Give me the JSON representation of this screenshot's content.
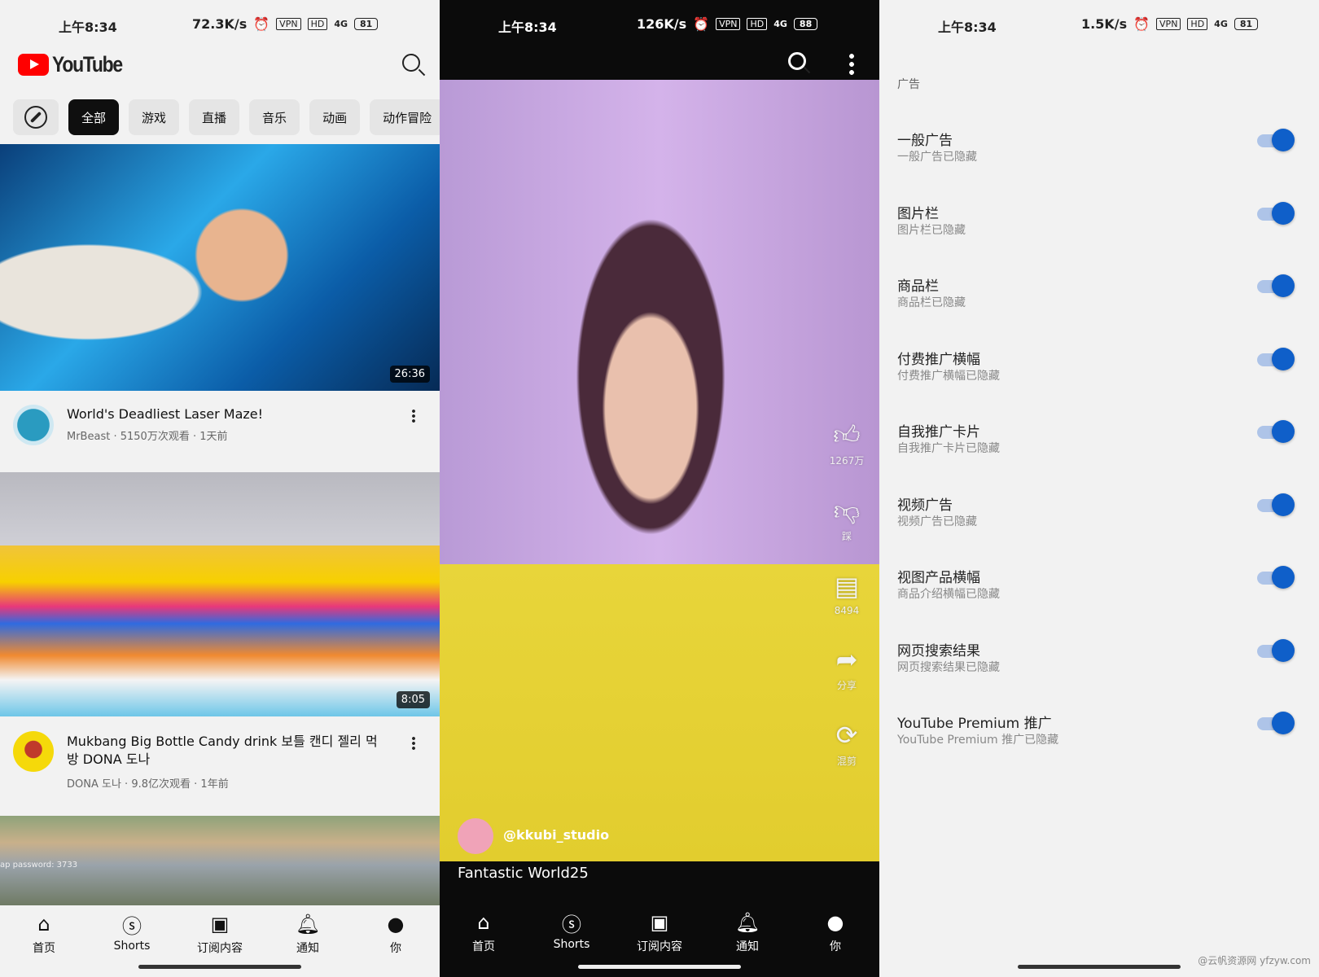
{
  "panel_home": {
    "status": {
      "time": "上午8:34",
      "speed": "72.3K/s",
      "vpn": "VPN",
      "hd": "HD",
      "net": "4G",
      "battery": "81"
    },
    "logo_text": "YouTube",
    "chips": [
      "全部",
      "游戏",
      "直播",
      "音乐",
      "动画",
      "动作冒险"
    ],
    "videos": [
      {
        "title": "World's Deadliest Laser Maze!",
        "channel": "MrBeast",
        "views": "5150万次观看",
        "age": "1天前",
        "duration": "26:36"
      },
      {
        "title": "Mukbang Big Bottle Candy drink 보틀 캔디 젤리 먹방 DONA 도나",
        "channel": "DONA 도나",
        "views": "9.8亿次观看",
        "age": "1年前",
        "duration": "8:05"
      }
    ],
    "third_thumb_overlay": "ap password: 3733",
    "nav": [
      "首页",
      "Shorts",
      "订阅内容",
      "通知",
      "你"
    ]
  },
  "panel_shorts": {
    "status": {
      "time": "上午8:34",
      "speed": "126K/s",
      "vpn": "VPN",
      "hd": "HD",
      "net": "4G",
      "battery": "88"
    },
    "actions": {
      "like": "1267万",
      "dislike": "踩",
      "comments": "8494",
      "share": "分享",
      "remix": "混剪"
    },
    "channel": "@kkubi_studio",
    "caption": "Fantastic World25",
    "nav": [
      "首页",
      "Shorts",
      "订阅内容",
      "通知",
      "你"
    ]
  },
  "panel_settings": {
    "status": {
      "time": "上午8:34",
      "speed": "1.5K/s",
      "vpn": "VPN",
      "hd": "HD",
      "net": "4G",
      "battery": "81"
    },
    "section": "广告",
    "accent": "#0f5fc9",
    "items": [
      {
        "title": "一般广告",
        "subtitle": "一般广告已隐藏",
        "enabled": true
      },
      {
        "title": "图片栏",
        "subtitle": "图片栏已隐藏",
        "enabled": true
      },
      {
        "title": "商品栏",
        "subtitle": "商品栏已隐藏",
        "enabled": true
      },
      {
        "title": "付费推广横幅",
        "subtitle": "付费推广横幅已隐藏",
        "enabled": true
      },
      {
        "title": "自我推广卡片",
        "subtitle": "自我推广卡片已隐藏",
        "enabled": true
      },
      {
        "title": "视频广告",
        "subtitle": "视频广告已隐藏",
        "enabled": true
      },
      {
        "title": "视图产品横幅",
        "subtitle": "商品介绍横幅已隐藏",
        "enabled": true
      },
      {
        "title": "网页搜索结果",
        "subtitle": "网页搜索结果已隐藏",
        "enabled": true
      },
      {
        "title": "YouTube Premium 推广",
        "subtitle": "YouTube Premium 推广已隐藏",
        "enabled": true
      }
    ],
    "watermark": "@云帆资源网 yfzyw.com"
  }
}
